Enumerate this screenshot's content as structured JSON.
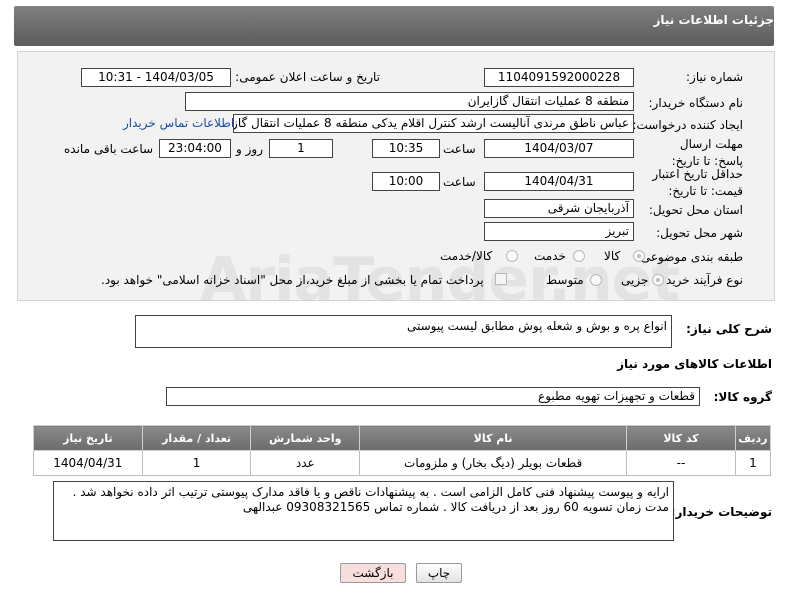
{
  "header": {
    "title": "جزئیات اطلاعات نیاز"
  },
  "form": {
    "need_number": {
      "label": "شماره نیاز:",
      "value": "1104091592000228"
    },
    "announce_datetime": {
      "label": "تاریخ و ساعت اعلان عمومی:",
      "value": "1404/03/05 - 10:31"
    },
    "buyer_org": {
      "label": "نام دستگاه خریدار:",
      "value": "منطقه 8 عملیات انتقال گازایران"
    },
    "requester": {
      "label": "ایجاد کننده درخواست:",
      "value": "عباس ناطق مرندی آنالیست ارشد کنترل اقلام یدکی منطقه 8 عملیات انتقال گازا",
      "contact_link": "اطلاعات تماس خریدار"
    },
    "deadline": {
      "label": "مهلت ارسال پاسخ: تا تاریخ:",
      "date": "1404/03/07",
      "time_label": "ساعت",
      "time": "10:35",
      "days": "1",
      "days_label": "روز و",
      "remaining": "23:04:00",
      "remaining_label": "ساعت باقی مانده"
    },
    "price_validity": {
      "label": "حداقل تاریخ اعتبار قیمت: تا تاریخ:",
      "date": "1404/04/31",
      "time_label": "ساعت",
      "time": "10:00"
    },
    "province": {
      "label": "استان محل تحویل:",
      "value": "آذربایجان شرقی"
    },
    "city": {
      "label": "شهر محل تحویل:",
      "value": "تبریز"
    },
    "category": {
      "label": "طبقه بندی موضوعی:",
      "options": [
        "کالا",
        "خدمت",
        "کالا/خدمت"
      ],
      "selected": "کالا"
    },
    "process": {
      "label": "نوع فرآیند خرید :",
      "options": [
        "جزیی",
        "متوسط"
      ],
      "selected": "جزیی",
      "checkbox_text": "پرداخت تمام یا بخشی از مبلغ خرید،از محل \"اسناد خزانه اسلامی\" خواهد بود."
    }
  },
  "summary": {
    "label": "شرح کلی نیاز:",
    "value": "انواع پره و بوش و شعله پوش مطابق لیست پیوستی"
  },
  "goods_section": {
    "title": "اطلاعات کالاهای مورد نیاز",
    "group_label": "گروه کالا:",
    "group_value": "قطعات و تجهیزات تهویه مطبوع"
  },
  "table": {
    "headers": [
      "ردیف",
      "کد کالا",
      "نام کالا",
      "واحد شمارش",
      "تعداد / مقدار",
      "تاریخ نیاز"
    ],
    "rows": [
      [
        "1",
        "--",
        "قطعات بویلر (دیگ بخار) و ملزومات",
        "عدد",
        "1",
        "1404/04/31"
      ]
    ]
  },
  "buyer_notes": {
    "label": "توضیحات خریدار:",
    "value": "ارایه و پیوست پیشنهاد فنی کامل الزامی است . به پیشنهادات ناقص و یا فاقد مدارک پیوستی ترتیب اثر داده نخواهد شد . مدت زمان تسویه 60 روز بعد از دریافت کالا . شماره تماس 09308321565 عبدالهی"
  },
  "buttons": {
    "print": "چاپ",
    "back": "بازگشت"
  },
  "colors": {
    "header": "#6b6b6b",
    "link": "#1a4ea8",
    "back_button_bg": "#f9dede"
  }
}
